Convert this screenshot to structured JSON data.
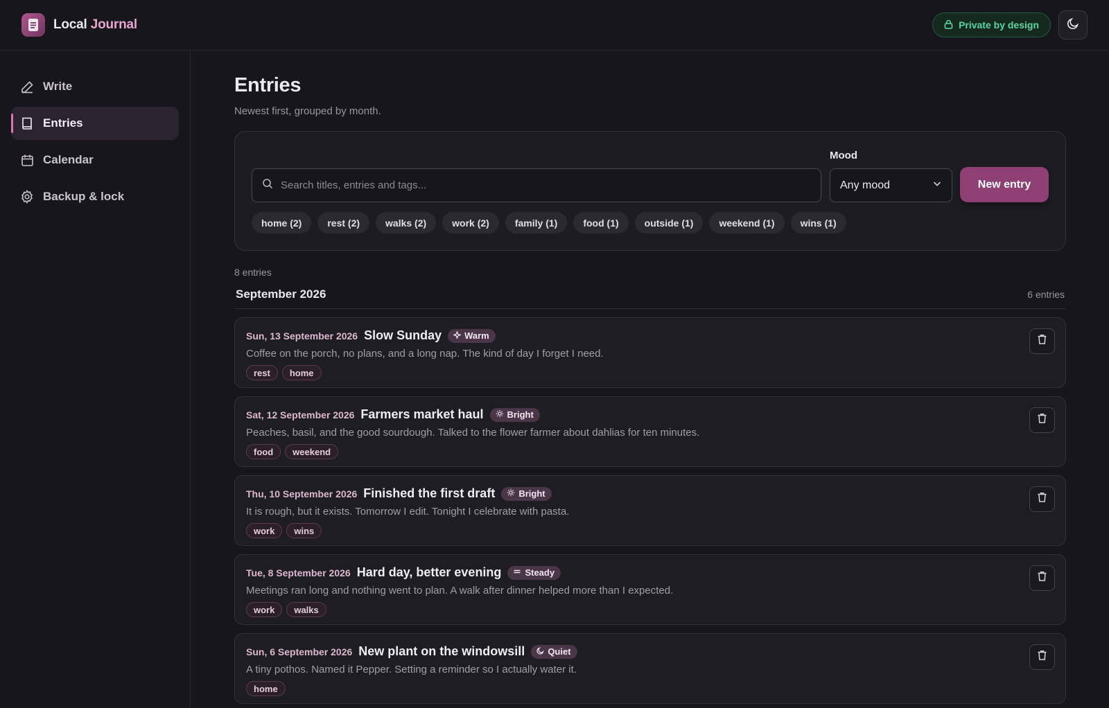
{
  "app": {
    "brand_primary": "Local",
    "brand_accent": "Journal",
    "privacy_badge": "Private by design",
    "icons": {
      "logo": "document-icon",
      "lock": "lock-icon",
      "theme": "moon-icon"
    }
  },
  "colors": {
    "background": "#17161c",
    "accent": "#8e3f73",
    "accent_light": "#e6a6cf",
    "privacy_green": "#58d6a0"
  },
  "sidebar": {
    "items": [
      {
        "label": "Write",
        "icon": "pencil-icon",
        "active": false
      },
      {
        "label": "Entries",
        "icon": "book-icon",
        "active": true
      },
      {
        "label": "Calendar",
        "icon": "calendar-icon",
        "active": false
      },
      {
        "label": "Backup & lock",
        "icon": "gear-icon",
        "active": false
      }
    ]
  },
  "page": {
    "title": "Entries",
    "subtitle": "Newest first, grouped by month."
  },
  "filters": {
    "search_placeholder": "Search titles, entries and tags...",
    "search_value": "",
    "mood_label": "Mood",
    "mood_selected": "Any mood",
    "new_entry_label": "New entry",
    "tags": [
      "home (2)",
      "rest (2)",
      "walks (2)",
      "work (2)",
      "family (1)",
      "food (1)",
      "outside (1)",
      "weekend (1)",
      "wins (1)"
    ]
  },
  "summary": {
    "total_entries": "8 entries"
  },
  "month": {
    "title": "September 2026",
    "count": "6 entries",
    "entries": [
      {
        "date": "Sun, 13 September 2026",
        "title": "Slow Sunday",
        "mood": "Warm",
        "mood_icon": "sparkle-icon",
        "body": "Coffee on the porch, no plans, and a long nap. The kind of day I forget I need.",
        "tags": [
          "rest",
          "home"
        ]
      },
      {
        "date": "Sat, 12 September 2026",
        "title": "Farmers market haul",
        "mood": "Bright",
        "mood_icon": "sun-icon",
        "body": "Peaches, basil, and the good sourdough. Talked to the flower farmer about dahlias for ten minutes.",
        "tags": [
          "food",
          "weekend"
        ]
      },
      {
        "date": "Thu, 10 September 2026",
        "title": "Finished the first draft",
        "mood": "Bright",
        "mood_icon": "sun-icon",
        "body": "It is rough, but it exists. Tomorrow I edit. Tonight I celebrate with pasta.",
        "tags": [
          "work",
          "wins"
        ]
      },
      {
        "date": "Tue, 8 September 2026",
        "title": "Hard day, better evening",
        "mood": "Steady",
        "mood_icon": "equals-icon",
        "body": "Meetings ran long and nothing went to plan. A walk after dinner helped more than I expected.",
        "tags": [
          "work",
          "walks"
        ]
      },
      {
        "date": "Sun, 6 September 2026",
        "title": "New plant on the windowsill",
        "mood": "Quiet",
        "mood_icon": "moon-icon",
        "body": "A tiny pothos. Named it Pepper. Setting a reminder so I actually water it.",
        "tags": [
          "home"
        ]
      }
    ]
  }
}
